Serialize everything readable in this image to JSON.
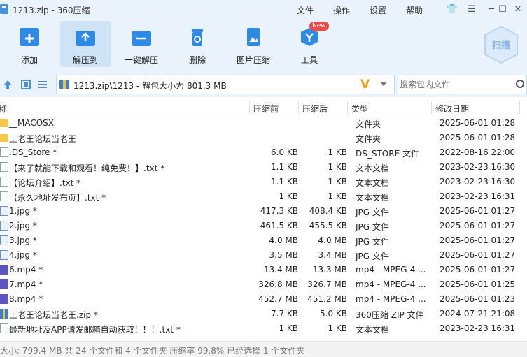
{
  "window": {
    "title": "1213.zip - 360压缩"
  },
  "menu": [
    "文件",
    "操作",
    "设置",
    "帮助"
  ],
  "toolbar": {
    "add": "添加",
    "extract_to": "解压到",
    "one_click_extract": "一键解压",
    "delete": "删除",
    "image_compress": "图片压缩",
    "tools": "工具",
    "new_badge": "New",
    "scan": "扫描"
  },
  "address": {
    "path": "1213.zip\\1213 - 解包大小为 801.3 MB"
  },
  "search": {
    "placeholder": "搜索包内文件"
  },
  "columns": {
    "name": "名称",
    "compressed": "压缩前",
    "uncompressed": "压缩后",
    "type": "类型",
    "modified": "修改日期"
  },
  "files": [
    {
      "icon": "folder",
      "name": "__MACOSX",
      "compressed": "",
      "uncompressed": "",
      "type": "文件夹",
      "date": "2025-06-01 01:28"
    },
    {
      "icon": "folder",
      "name": "上老王论坛当老王",
      "compressed": "",
      "uncompressed": "",
      "type": "文件夹",
      "date": "2025-06-01 01:28"
    },
    {
      "icon": "doc",
      "name": ".DS_Store *",
      "compressed": "6.0 KB",
      "uncompressed": "1 KB",
      "type": "DS_STORE 文件",
      "date": "2022-08-16 22:00"
    },
    {
      "icon": "doc",
      "name": "【来了就能下载和观看！纯免费！】.txt *",
      "compressed": "1.1 KB",
      "uncompressed": "1 KB",
      "type": "文本文档",
      "date": "2023-02-23 16:30"
    },
    {
      "icon": "doc",
      "name": "【论坛介绍】.txt *",
      "compressed": "1.1 KB",
      "uncompressed": "1 KB",
      "type": "文本文档",
      "date": "2023-02-23 16:30"
    },
    {
      "icon": "doc",
      "name": "【永久地址发布页】.txt *",
      "compressed": "1 KB",
      "uncompressed": "1 KB",
      "type": "文本文档",
      "date": "2023-02-23 16:31"
    },
    {
      "icon": "img",
      "name": "1.jpg *",
      "compressed": "417.3 KB",
      "uncompressed": "408.4 KB",
      "type": "JPG 文件",
      "date": "2025-06-01 01:27"
    },
    {
      "icon": "img",
      "name": "2.jpg *",
      "compressed": "461.5 KB",
      "uncompressed": "455.5 KB",
      "type": "JPG 文件",
      "date": "2025-06-01 01:27"
    },
    {
      "icon": "img",
      "name": "3.jpg *",
      "compressed": "4.0 MB",
      "uncompressed": "4.0 MB",
      "type": "JPG 文件",
      "date": "2025-06-01 01:27"
    },
    {
      "icon": "img",
      "name": "4.jpg *",
      "compressed": "3.5 MB",
      "uncompressed": "3.4 MB",
      "type": "JPG 文件",
      "date": "2025-06-01 01:27"
    },
    {
      "icon": "vid",
      "name": "6.mp4 *",
      "compressed": "13.4 MB",
      "uncompressed": "13.3 MB",
      "type": "mp4 - MPEG-4 ...",
      "date": "2025-06-01 01:27"
    },
    {
      "icon": "vid",
      "name": "7.mp4 *",
      "compressed": "326.8 MB",
      "uncompressed": "326.7 MB",
      "type": "mp4 - MPEG-4 ...",
      "date": "2025-06-01 01:25"
    },
    {
      "icon": "vid",
      "name": "8.mp4 *",
      "compressed": "452.7 MB",
      "uncompressed": "451.2 MB",
      "type": "mp4 - MPEG-4 ...",
      "date": "2025-06-01 01:23"
    },
    {
      "icon": "zip",
      "name": "上老王论坛当老王.zip *",
      "compressed": "7.7 KB",
      "uncompressed": "5.0 KB",
      "type": "360压缩 ZIP 文件",
      "date": "2024-07-21 21:08"
    },
    {
      "icon": "doc",
      "name": "最新地址及APP请发邮箱自动获取！！！.txt *",
      "compressed": "1 KB",
      "uncompressed": "1 KB",
      "type": "文本文档",
      "date": "2023-02-23 16:31"
    }
  ],
  "status": {
    "text": "大小: 799.4 MB 共 24 个文件和 4 个文件夹 压缩率 99.8% 已经选择 1 个文件夹"
  }
}
